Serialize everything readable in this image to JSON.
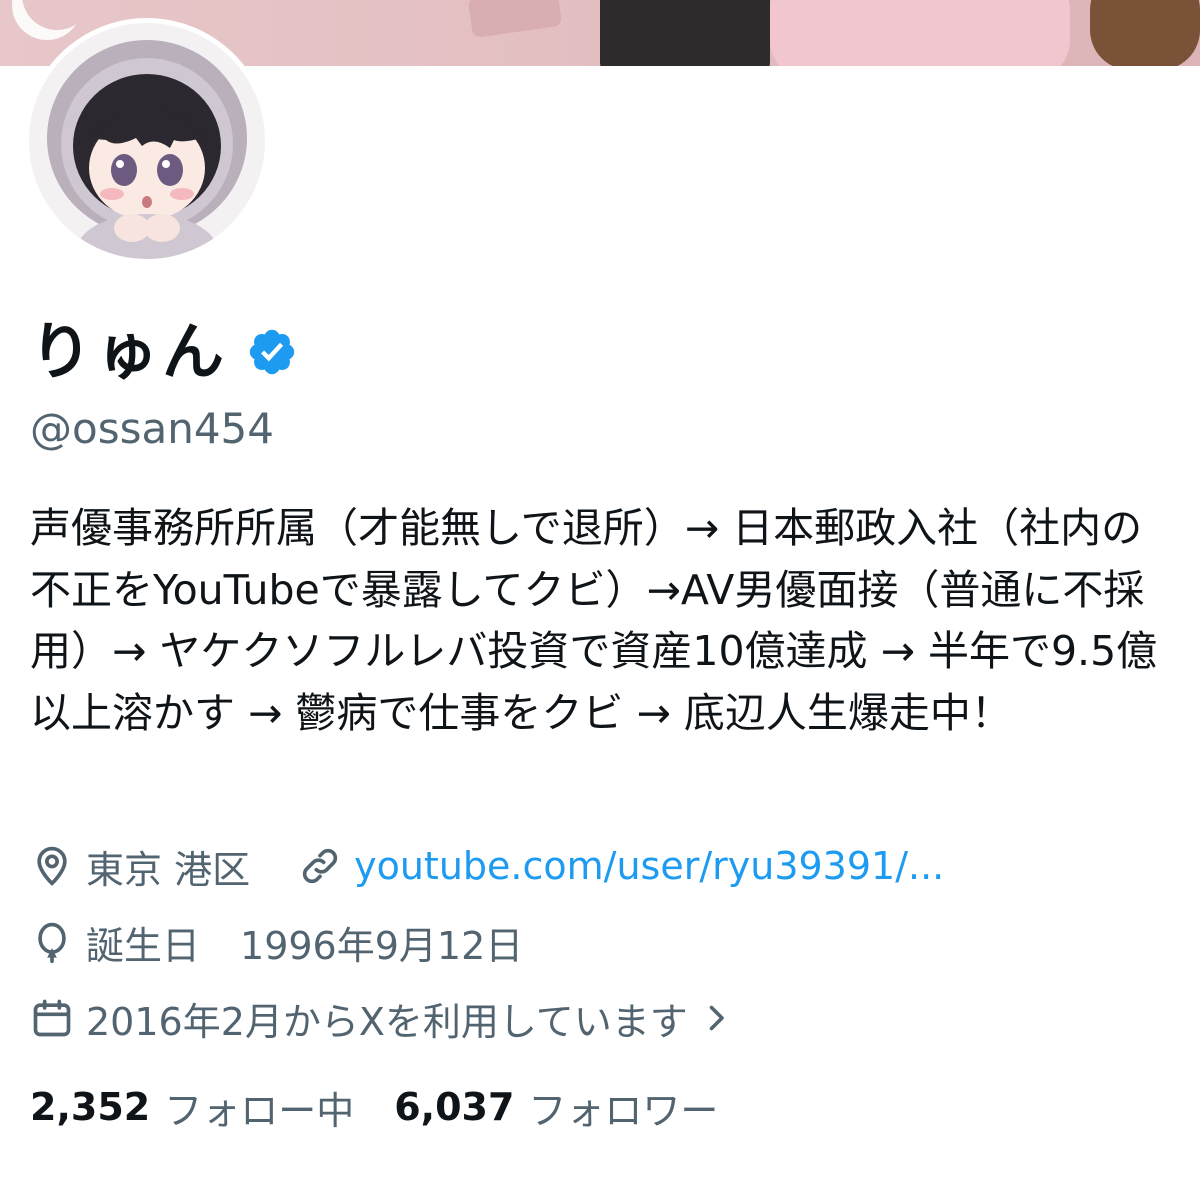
{
  "profile": {
    "display_name": "りゅん",
    "verified_icon": "verified-badge-icon",
    "handle": "@ossan454",
    "bio": "声優事務所所属（才能無しで退所）→ 日本郵政入社（社内の不正をYouTubeで暴露してクビ）→AV男優面接（普通に不採用）→ ヤケクソフルレバ投資で資産10億達成 → 半年で9.5億以上溶かす → 鬱病で仕事をクビ → 底辺人生爆走中！",
    "location": "東京 港区",
    "link": "youtube.com/user/ryu39391/...",
    "birthday_label": "誕生日",
    "birthday_value": "1996年9月12日",
    "joined": "2016年2月からXを利用しています",
    "following_count": "2,352",
    "following_label": "フォロー中",
    "followers_count": "6,037",
    "followers_label": "フォロワー"
  },
  "colors": {
    "accent": "#1d9bf0",
    "secondary_text": "#536471",
    "primary_text": "#0f1419",
    "banner": "#e3bfc2"
  }
}
